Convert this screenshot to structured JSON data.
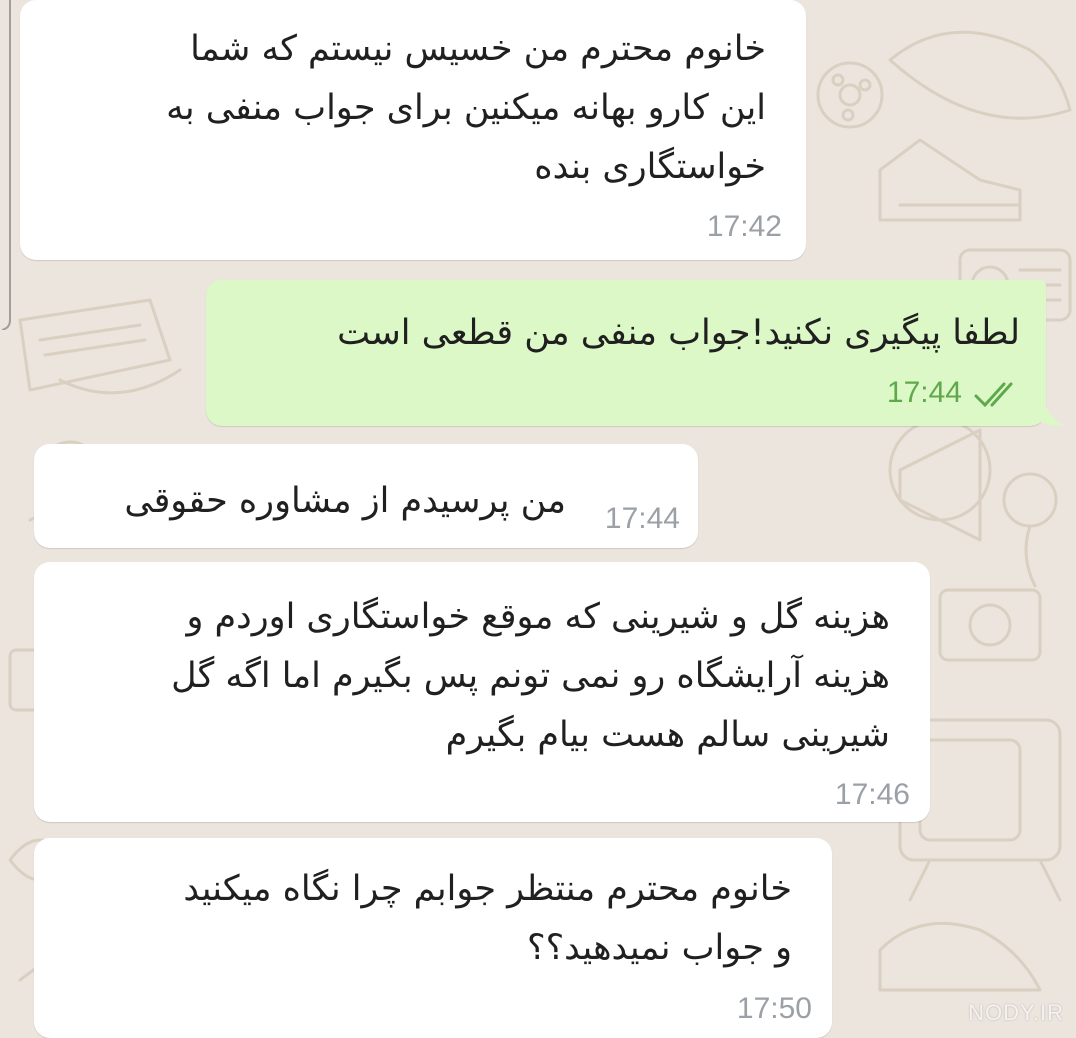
{
  "colors": {
    "wallpaper": "#ece5dd",
    "incoming_bubble": "#ffffff",
    "outgoing_bubble": "#dcf8c6",
    "timestamp": "#9aa0a6",
    "outgoing_timestamp": "#5fa84c",
    "read_ticks": "#5fa84c"
  },
  "messages": [
    {
      "direction": "incoming",
      "text": "خانوم محترم من خسیس نیستم که شما\nاین کارو بهانه میکنین برای جواب منفی به\nخواستگاری بنده",
      "time": "17:42"
    },
    {
      "direction": "outgoing",
      "text": "لطفا پیگیری نکنید!جواب منفی من قطعی است",
      "time": "17:44",
      "status_icon": "double-check-icon"
    },
    {
      "direction": "incoming",
      "text": "من پرسیدم از مشاوره حقوقی",
      "time": "17:44"
    },
    {
      "direction": "incoming",
      "text": "هزینه گل و شیرینی که موقع خواستگاری اوردم و\nهزینه آرایشگاه رو نمی تونم پس بگیرم اما اگه گل\nشیرینی سالم هست بیام بگیرم",
      "time": "17:46"
    },
    {
      "direction": "incoming",
      "text": "خانوم محترم منتظر جوابم چرا نگاه میکنید\nو جواب نمیدهید؟؟",
      "time": "17:50"
    }
  ],
  "watermark": {
    "main": "NODY.IR"
  }
}
